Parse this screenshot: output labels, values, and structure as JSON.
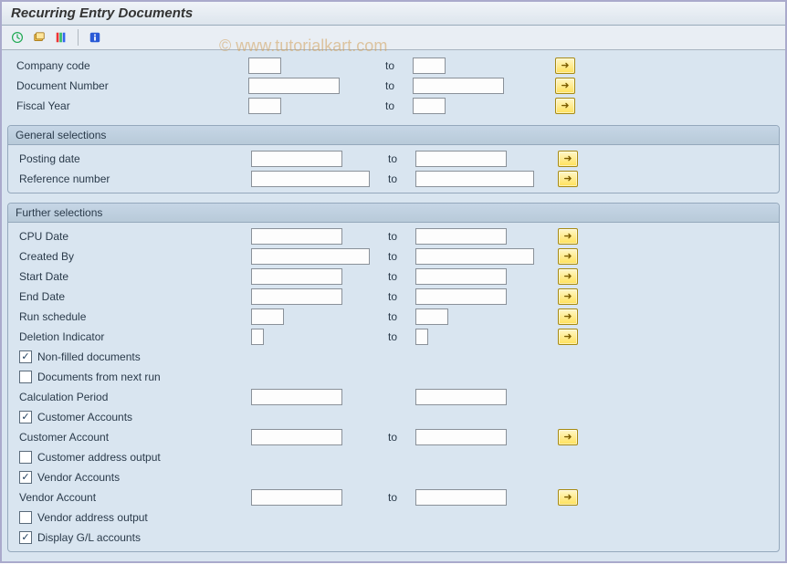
{
  "page": {
    "title": "Recurring Entry Documents"
  },
  "watermark": "© www.tutorialkart.com",
  "toolbar": {
    "execute_tip": "Execute",
    "variant_tip": "Get Variant",
    "options_tip": "Selection Options",
    "info_tip": "Information"
  },
  "labels": {
    "to": "to"
  },
  "top": {
    "company_code": {
      "label": "Company code",
      "from": "",
      "to": ""
    },
    "document_number": {
      "label": "Document Number",
      "from": "",
      "to": ""
    },
    "fiscal_year": {
      "label": "Fiscal Year",
      "from": "",
      "to": ""
    }
  },
  "general": {
    "title": "General selections",
    "posting_date": {
      "label": "Posting date",
      "from": "",
      "to": ""
    },
    "reference_number": {
      "label": "Reference number",
      "from": "",
      "to": ""
    }
  },
  "further": {
    "title": "Further selections",
    "cpu_date": {
      "label": "CPU Date",
      "from": "",
      "to": ""
    },
    "created_by": {
      "label": "Created By",
      "from": "",
      "to": ""
    },
    "start_date": {
      "label": "Start Date",
      "from": "",
      "to": ""
    },
    "end_date": {
      "label": "End Date",
      "from": "",
      "to": ""
    },
    "run_schedule": {
      "label": "Run schedule",
      "from": "",
      "to": ""
    },
    "deletion_ind": {
      "label": "Deletion Indicator",
      "from": "",
      "to": ""
    },
    "non_filled": {
      "label": "Non-filled documents",
      "checked": true
    },
    "docs_next_run": {
      "label": "Documents from next run",
      "checked": false
    },
    "calc_period": {
      "label": "Calculation Period",
      "from": "",
      "to": ""
    },
    "cust_accounts": {
      "label": "Customer Accounts",
      "checked": true
    },
    "cust_account": {
      "label": "Customer Account",
      "from": "",
      "to": ""
    },
    "cust_addr_out": {
      "label": "Customer address output",
      "checked": false
    },
    "vend_accounts": {
      "label": "Vendor Accounts",
      "checked": true
    },
    "vend_account": {
      "label": "Vendor Account",
      "from": "",
      "to": ""
    },
    "vend_addr_out": {
      "label": "Vendor address output",
      "checked": false
    },
    "display_gl": {
      "label": "Display G/L accounts",
      "checked": true
    }
  }
}
